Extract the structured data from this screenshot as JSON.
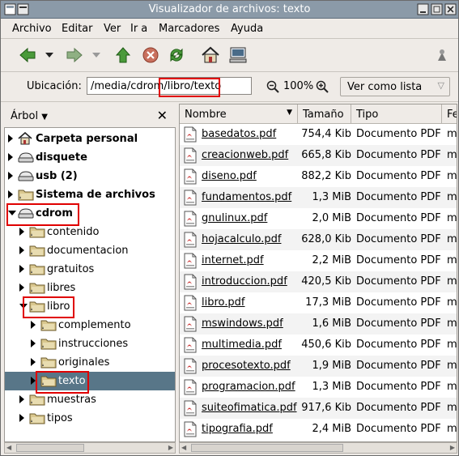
{
  "window": {
    "title": "Visualizador de archivos: texto"
  },
  "menu": [
    "Archivo",
    "Editar",
    "Ver",
    "Ir a",
    "Marcadores",
    "Ayuda"
  ],
  "toolbar": {
    "icons": [
      "back-arrow-icon",
      "dropdown-arrow-icon",
      "forward-arrow-icon",
      "dropdown-arrow-icon",
      "up-arrow-icon",
      "stop-icon",
      "reload-icon",
      "home-icon",
      "computer-icon",
      "throbber-icon"
    ]
  },
  "location": {
    "label": "Ubicación:",
    "value": "/media/cdrom/libro/texto",
    "zoom": "100%",
    "view_as": "Ver como lista"
  },
  "sidebar": {
    "label": "Árbol",
    "close": "✕",
    "tree": [
      {
        "label": "Carpeta personal",
        "level": 0,
        "expander": "right",
        "bold": true,
        "icon": "home-icon"
      },
      {
        "label": "disquete",
        "level": 0,
        "expander": "right",
        "bold": true,
        "icon": "drive-icon"
      },
      {
        "label": "usb (2)",
        "level": 0,
        "expander": "right",
        "bold": true,
        "icon": "drive-icon"
      },
      {
        "label": "Sistema de archivos",
        "level": 0,
        "expander": "right",
        "bold": true,
        "icon": "folder-icon"
      },
      {
        "label": "cdrom",
        "level": 0,
        "expander": "down",
        "bold": true,
        "icon": "drive-icon"
      },
      {
        "label": "contenido",
        "level": 1,
        "expander": "right",
        "bold": false,
        "icon": "folder-icon"
      },
      {
        "label": "documentacion",
        "level": 1,
        "expander": "right",
        "bold": false,
        "icon": "folder-icon"
      },
      {
        "label": "gratuitos",
        "level": 1,
        "expander": "right",
        "bold": false,
        "icon": "folder-icon"
      },
      {
        "label": "libres",
        "level": 1,
        "expander": "right",
        "bold": false,
        "icon": "folder-icon"
      },
      {
        "label": "libro",
        "level": 1,
        "expander": "down",
        "bold": false,
        "icon": "folder-icon"
      },
      {
        "label": "complemento",
        "level": 2,
        "expander": "right",
        "bold": false,
        "icon": "folder-icon"
      },
      {
        "label": "instrucciones",
        "level": 2,
        "expander": "right",
        "bold": false,
        "icon": "folder-icon"
      },
      {
        "label": "originales",
        "level": 2,
        "expander": "right",
        "bold": false,
        "icon": "folder-icon"
      },
      {
        "label": "texto",
        "level": 2,
        "expander": "right",
        "bold": false,
        "icon": "folder-icon",
        "selected": true
      },
      {
        "label": "muestras",
        "level": 1,
        "expander": "right",
        "bold": false,
        "icon": "folder-icon"
      },
      {
        "label": "tipos",
        "level": 1,
        "expander": "right",
        "bold": false,
        "icon": "folder-icon"
      }
    ]
  },
  "filelist": {
    "columns": [
      "Nombre",
      "Tamaño",
      "Tipo",
      "Fe"
    ],
    "files": [
      {
        "name": "basedatos.pdf",
        "size": "754,4 Kib",
        "type": "Documento PDF",
        "ext": "m"
      },
      {
        "name": "creacionweb.pdf",
        "size": "665,8 Kib",
        "type": "Documento PDF",
        "ext": "m"
      },
      {
        "name": "diseno.pdf",
        "size": "882,2 Kib",
        "type": "Documento PDF",
        "ext": "m"
      },
      {
        "name": "fundamentos.pdf",
        "size": "1,3 MiB",
        "type": "Documento PDF",
        "ext": "m"
      },
      {
        "name": "gnulinux.pdf",
        "size": "2,0 MiB",
        "type": "Documento PDF",
        "ext": "m"
      },
      {
        "name": "hojacalculo.pdf",
        "size": "628,0 Kib",
        "type": "Documento PDF",
        "ext": "m"
      },
      {
        "name": "internet.pdf",
        "size": "2,2 MiB",
        "type": "Documento PDF",
        "ext": "m"
      },
      {
        "name": "introduccion.pdf",
        "size": "420,5 Kib",
        "type": "Documento PDF",
        "ext": "m"
      },
      {
        "name": "libro.pdf",
        "size": "17,3 MiB",
        "type": "Documento PDF",
        "ext": "m"
      },
      {
        "name": "mswindows.pdf",
        "size": "1,6 MiB",
        "type": "Documento PDF",
        "ext": "m"
      },
      {
        "name": "multimedia.pdf",
        "size": "450,6 Kib",
        "type": "Documento PDF",
        "ext": "m"
      },
      {
        "name": "procesotexto.pdf",
        "size": "1,9 MiB",
        "type": "Documento PDF",
        "ext": "m"
      },
      {
        "name": "programacion.pdf",
        "size": "1,3 MiB",
        "type": "Documento PDF",
        "ext": "m"
      },
      {
        "name": "suiteofimatica.pdf",
        "size": "917,6 Kib",
        "type": "Documento PDF",
        "ext": "m"
      },
      {
        "name": "tipografia.pdf",
        "size": "2,4 MiB",
        "type": "Documento PDF",
        "ext": "m"
      }
    ]
  },
  "colors": {
    "titlebar": "#8b9aa8",
    "selection": "#587688",
    "highlight": "#e00000"
  }
}
